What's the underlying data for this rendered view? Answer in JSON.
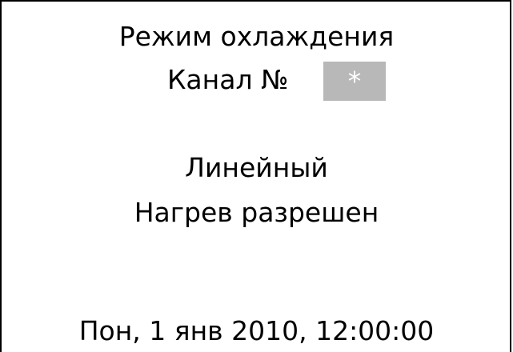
{
  "screen": {
    "title": "Режим охлаждения",
    "channel_label": "Канал №",
    "channel_value": "*",
    "mode": "Линейный",
    "heating_status": "Нагрев разрешен",
    "datetime": "Пон, 1 янв 2010, 12:00:00"
  },
  "colors": {
    "channel_box_background": "#b8b8b8",
    "channel_box_text": "#ffffff",
    "border": "#000000"
  }
}
